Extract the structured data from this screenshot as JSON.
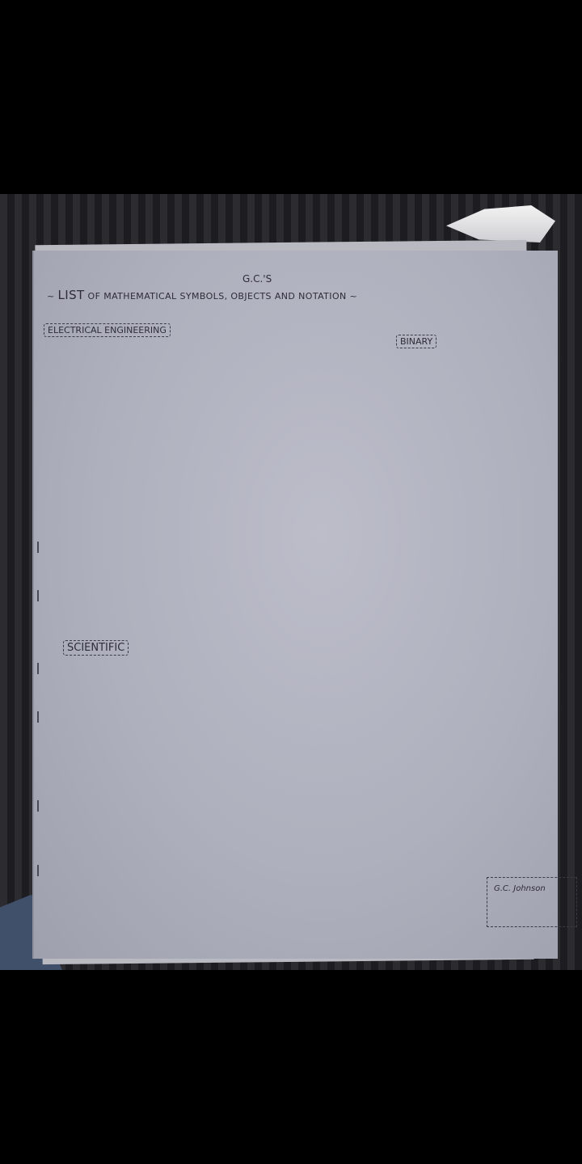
{
  "document": {
    "author_mark": "G.C.'S",
    "title_prefix": "~",
    "title_list": "LIST",
    "title_rest": " OF MATHEMATICAL SYMBOLS, OBJECTS AND NOTATION ~",
    "sections": {
      "electrical": "ELECTRICAL ENGINEERING",
      "binary": "BINARY",
      "scientific": "SCIENTIFIC"
    },
    "signature": "G.C. Johnson"
  }
}
